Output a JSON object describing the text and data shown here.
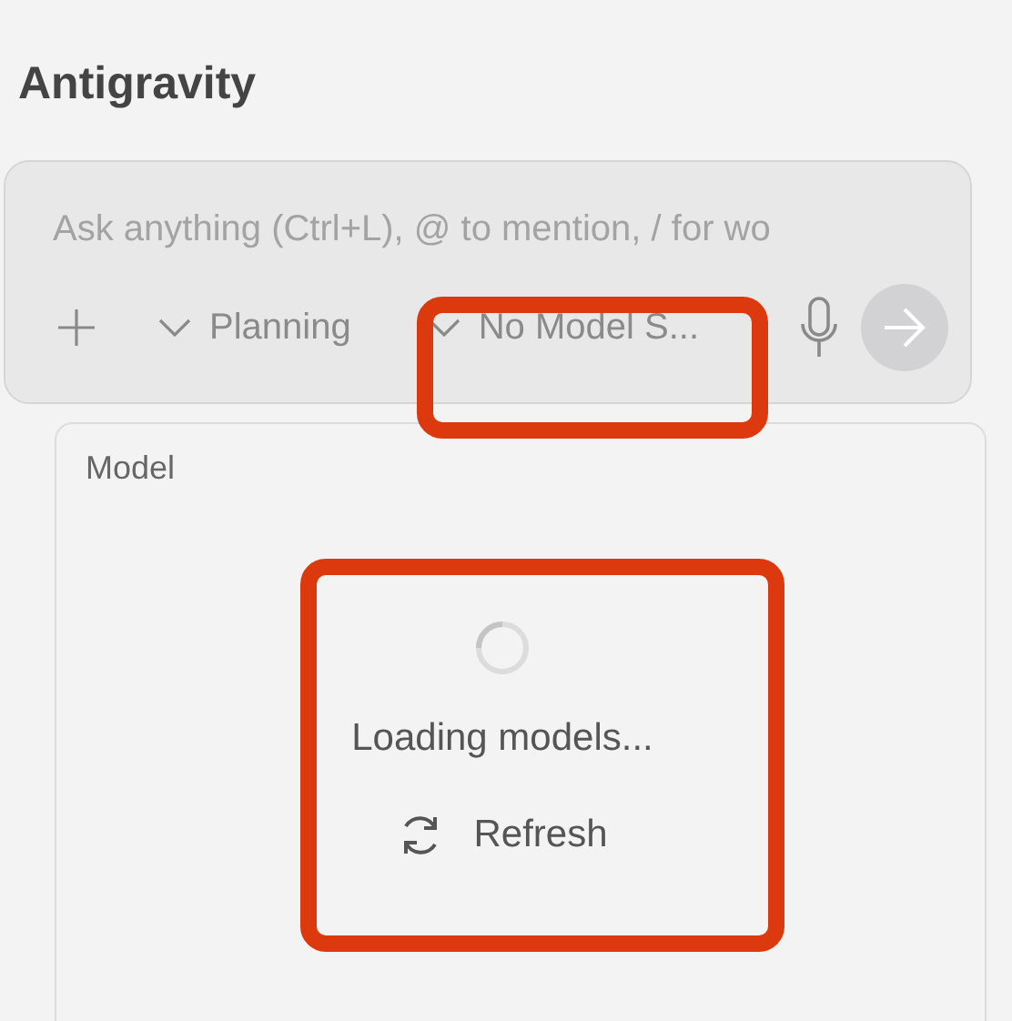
{
  "title": "Antigravity",
  "prompt": {
    "placeholder": "Ask anything (Ctrl+L), @ to mention, / for wo"
  },
  "mode": {
    "label": "Planning"
  },
  "model": {
    "label": "No Model S..."
  },
  "model_panel": {
    "heading": "Model",
    "status": "Loading models...",
    "refresh": "Refresh"
  }
}
